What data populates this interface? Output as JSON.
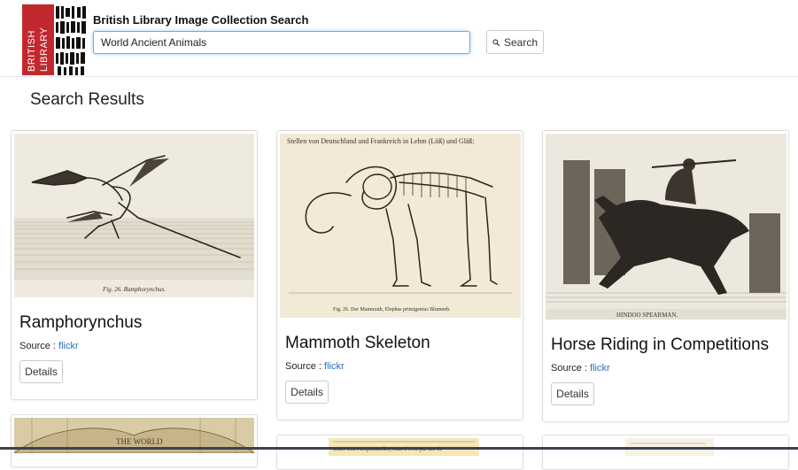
{
  "header": {
    "logo_text": [
      "BRITISH",
      "LIBRARY"
    ],
    "title": "British Library Image Collection Search",
    "search_value": "World Ancient Animals",
    "search_button": "Search"
  },
  "results": {
    "heading": "Search Results",
    "source_prefix": "Source : ",
    "details_label": "Details",
    "cards": [
      {
        "title": "Ramphorynchus",
        "source": "flickr",
        "caption": "Fig. 26.  Ramphorynchus."
      },
      {
        "title": "Mammoth Skeleton",
        "source": "flickr",
        "caption": "Fig. 26.  Der Mammuth, Elephas primigenius Blumenb.",
        "top_text": "Stellen von Deutschland und Frankreich in Lehm (Löß) und Gläß:"
      },
      {
        "title": "Horse Riding in Competitions",
        "source": "flickr",
        "caption": "HINDOO SPEARMAN."
      }
    ],
    "partial_cards": [
      {
        "top_text": "THE WORLD"
      },
      {
        "top_text": "rature sont exceptionnelles, mais il n'est pas rare de"
      },
      {
        "top_text": ""
      }
    ]
  },
  "colors": {
    "link": "#2a6ebb",
    "logo_red": "#c3272e",
    "focus_border": "#66afe9"
  }
}
